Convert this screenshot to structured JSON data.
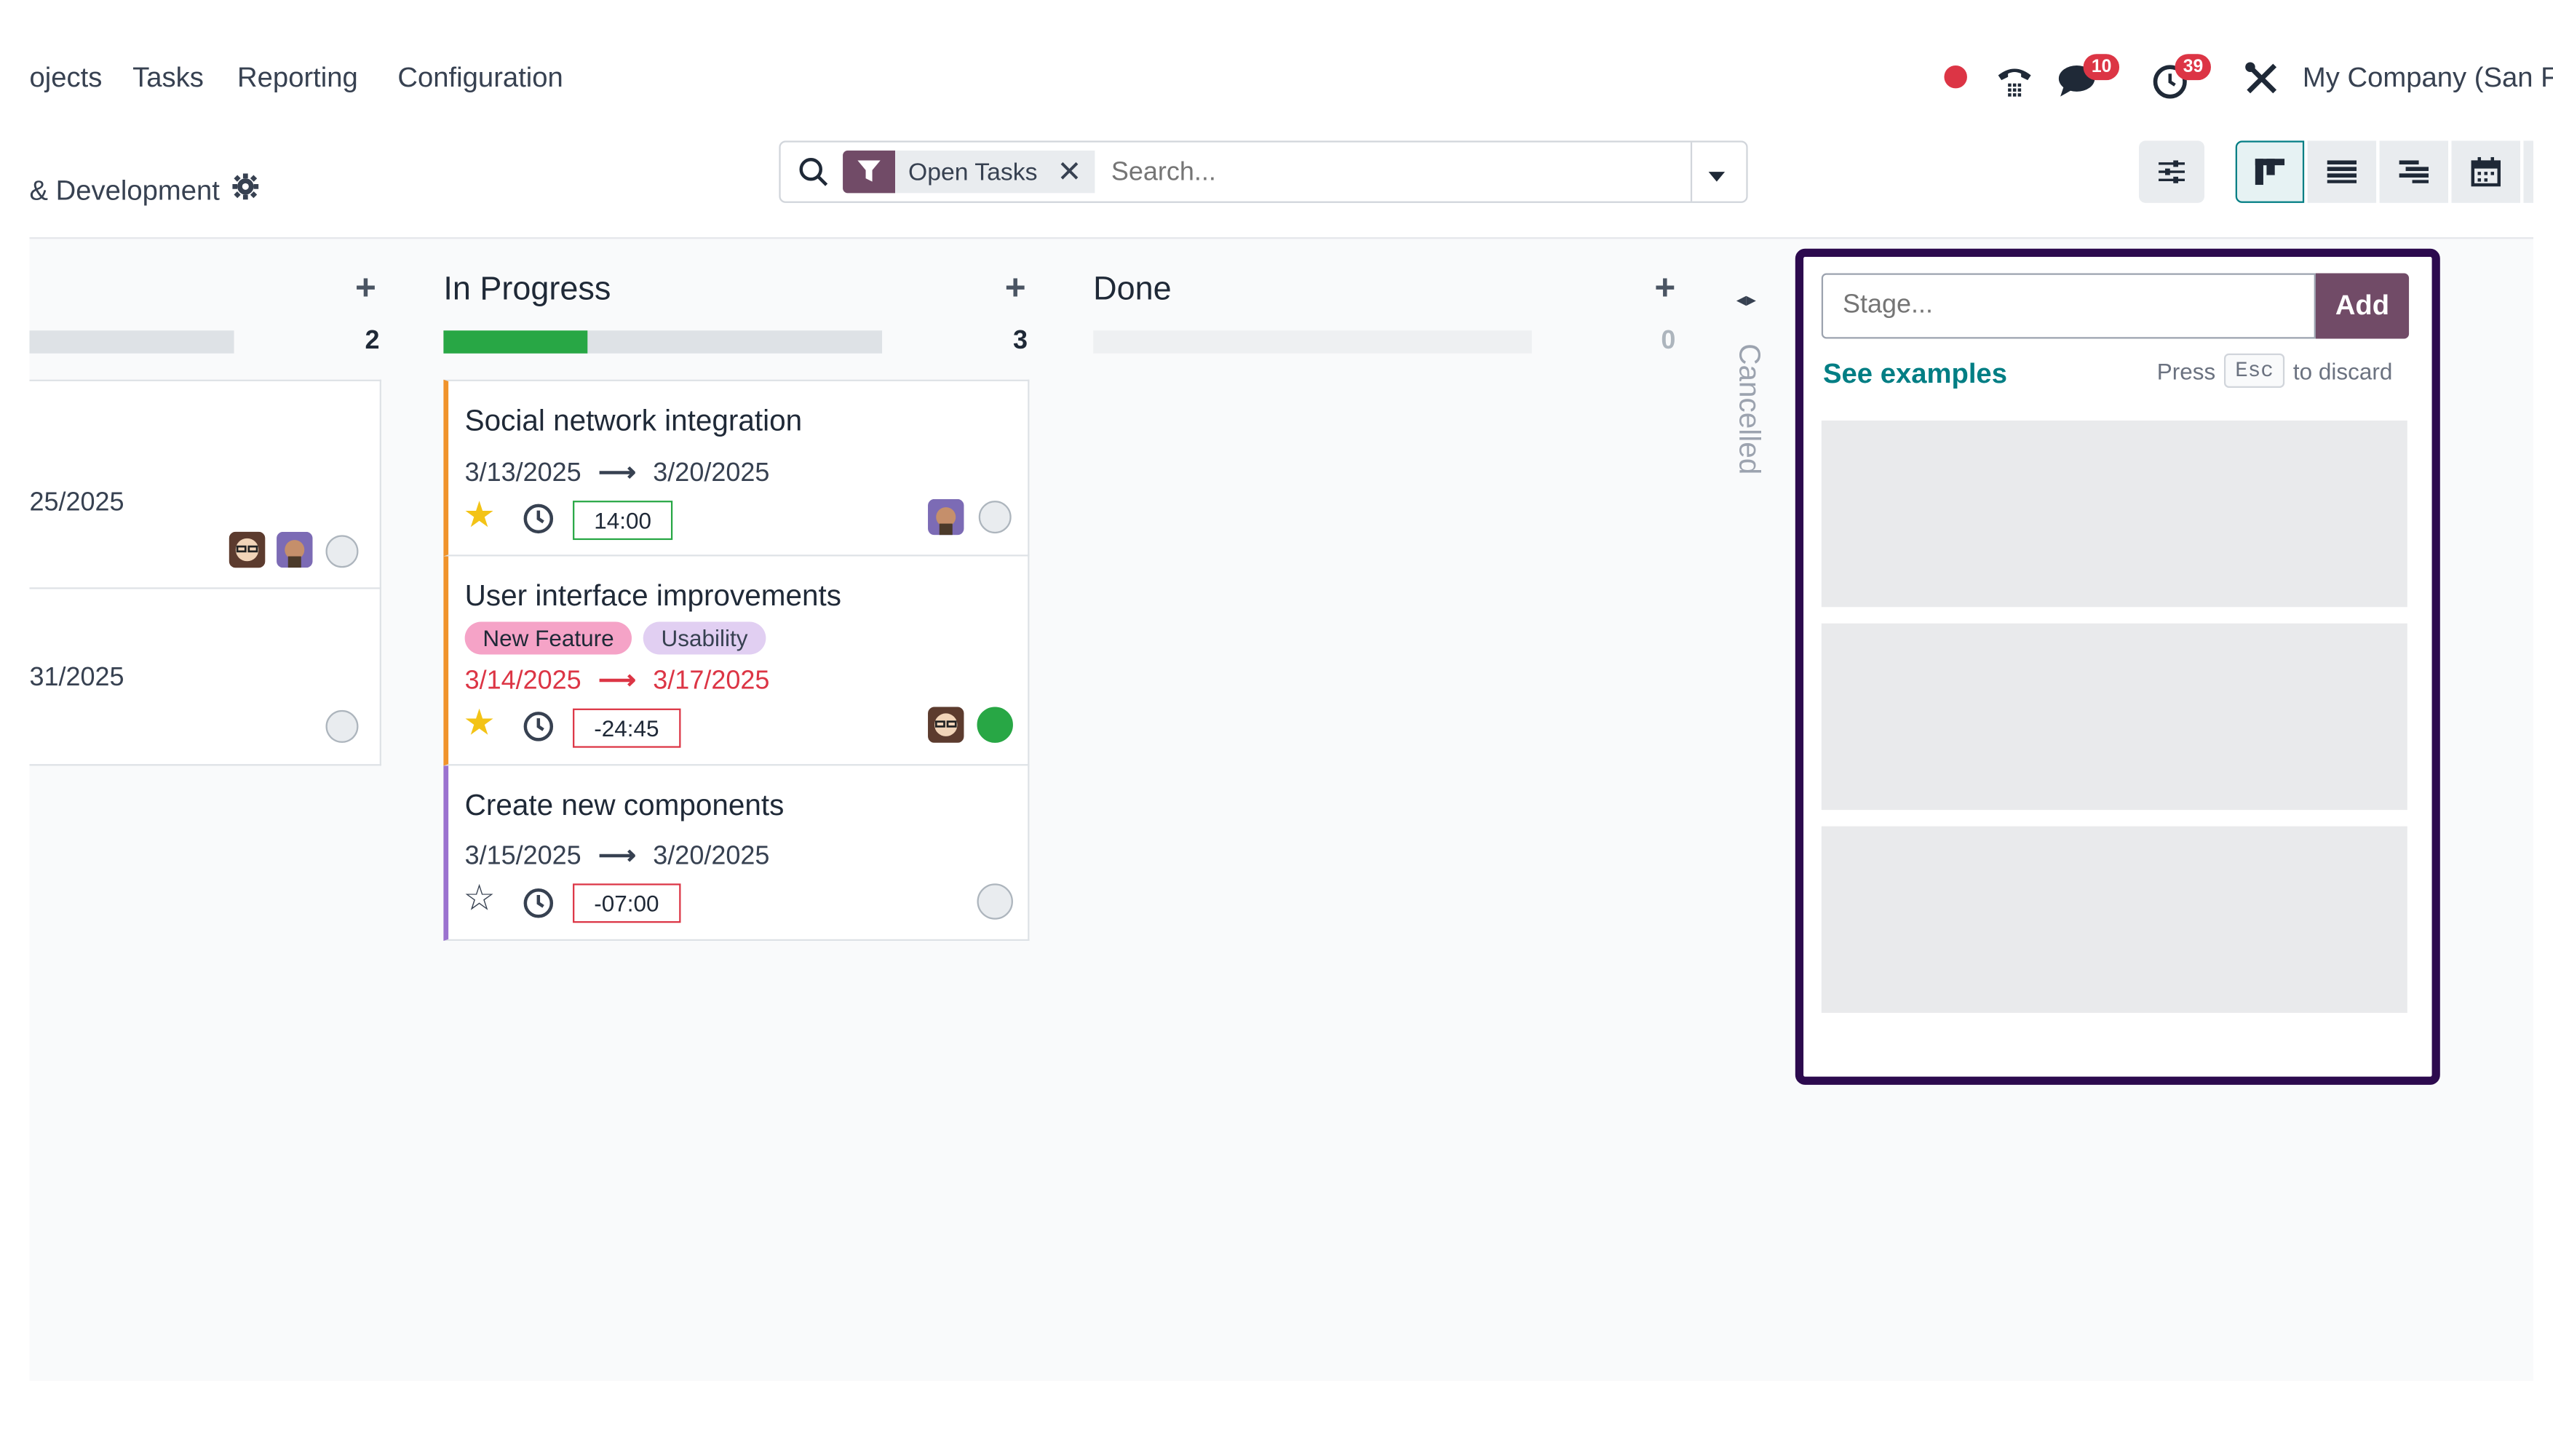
{
  "nav": {
    "items": [
      "ojects",
      "Tasks",
      "Reporting",
      "Configuration"
    ],
    "company": "My Company (San F",
    "chat_badge": "10",
    "activity_badge": "39"
  },
  "breadcrumb": {
    "project": "& Development"
  },
  "search": {
    "facet_label": "Open Tasks",
    "placeholder": "Search..."
  },
  "columns": [
    {
      "title": "",
      "count": "2",
      "progress": 0
    },
    {
      "title": "In Progress",
      "count": "3",
      "progress": 0.33
    },
    {
      "title": "Done",
      "count": "0",
      "progress": 0
    }
  ],
  "folded_column": {
    "title": "Cancelled"
  },
  "first_column_cards": [
    {
      "date_end": "25/2025"
    },
    {
      "date_end": "31/2025"
    }
  ],
  "cards": [
    {
      "title": "Social network integration",
      "date_start": "3/13/2025",
      "date_end": "3/20/2025",
      "time": "14:00",
      "starred": true,
      "overdue": false,
      "accent": "#f0932b"
    },
    {
      "title": "User interface improvements",
      "tags": [
        "New Feature",
        "Usability"
      ],
      "date_start": "3/14/2025",
      "date_end": "3/17/2025",
      "time": "-24:45",
      "starred": true,
      "overdue": true,
      "accent": "#f0932b"
    },
    {
      "title": "Create new components",
      "date_start": "3/15/2025",
      "date_end": "3/20/2025",
      "time": "-07:00",
      "starred": false,
      "overdue": false,
      "accent": "#9b72cf"
    }
  ],
  "quick_create": {
    "placeholder": "Stage...",
    "add_label": "Add",
    "examples_label": "See examples",
    "hint_press": "Press",
    "hint_key": "Esc",
    "hint_discard": "to discard"
  },
  "colors": {
    "brand": "#714B67",
    "highlight_border": "#2c0a4e",
    "progress_green": "#28a745",
    "danger": "#dc3545",
    "teal": "#017e84"
  }
}
